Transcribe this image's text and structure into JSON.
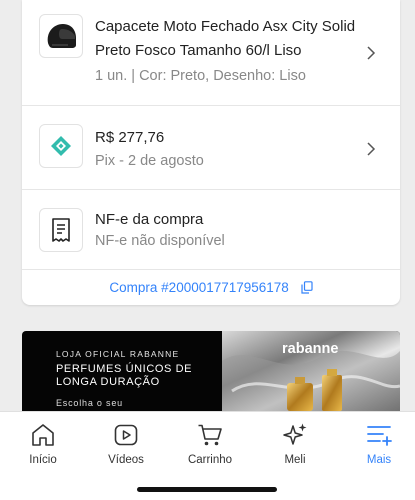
{
  "order_item": {
    "title": "Capacete Moto Fechado Asx City Solid Preto Fosco Tamanho 60/l Liso",
    "details": "1 un. | Cor: Preto, Desenho: Liso"
  },
  "payment": {
    "amount": "R$ 277,76",
    "method": "Pix - 2 de agosto"
  },
  "invoice": {
    "title": "NF-e da compra",
    "status": "NF-e não disponível"
  },
  "purchase": {
    "label": "Compra #2000017717956178"
  },
  "ad_banner": {
    "store": "LOJA OFICIAL RABANNE",
    "headline": "PERFUMES ÚNICOS DE LONGA DURAÇÃO",
    "cta": "Escolha o seu",
    "brand": "rabanne"
  },
  "tabbar": {
    "items": [
      {
        "label": "Início",
        "icon": "home-icon"
      },
      {
        "label": "Vídeos",
        "icon": "video-play-icon"
      },
      {
        "label": "Carrinho",
        "icon": "cart-icon"
      },
      {
        "label": "Meli",
        "icon": "sparkle-icon"
      },
      {
        "label": "Mais",
        "icon": "menu-plus-icon"
      }
    ],
    "active": "Mais"
  },
  "colors": {
    "accent": "#3483fa",
    "pix": "#32bcad",
    "text_secondary": "#888888"
  }
}
